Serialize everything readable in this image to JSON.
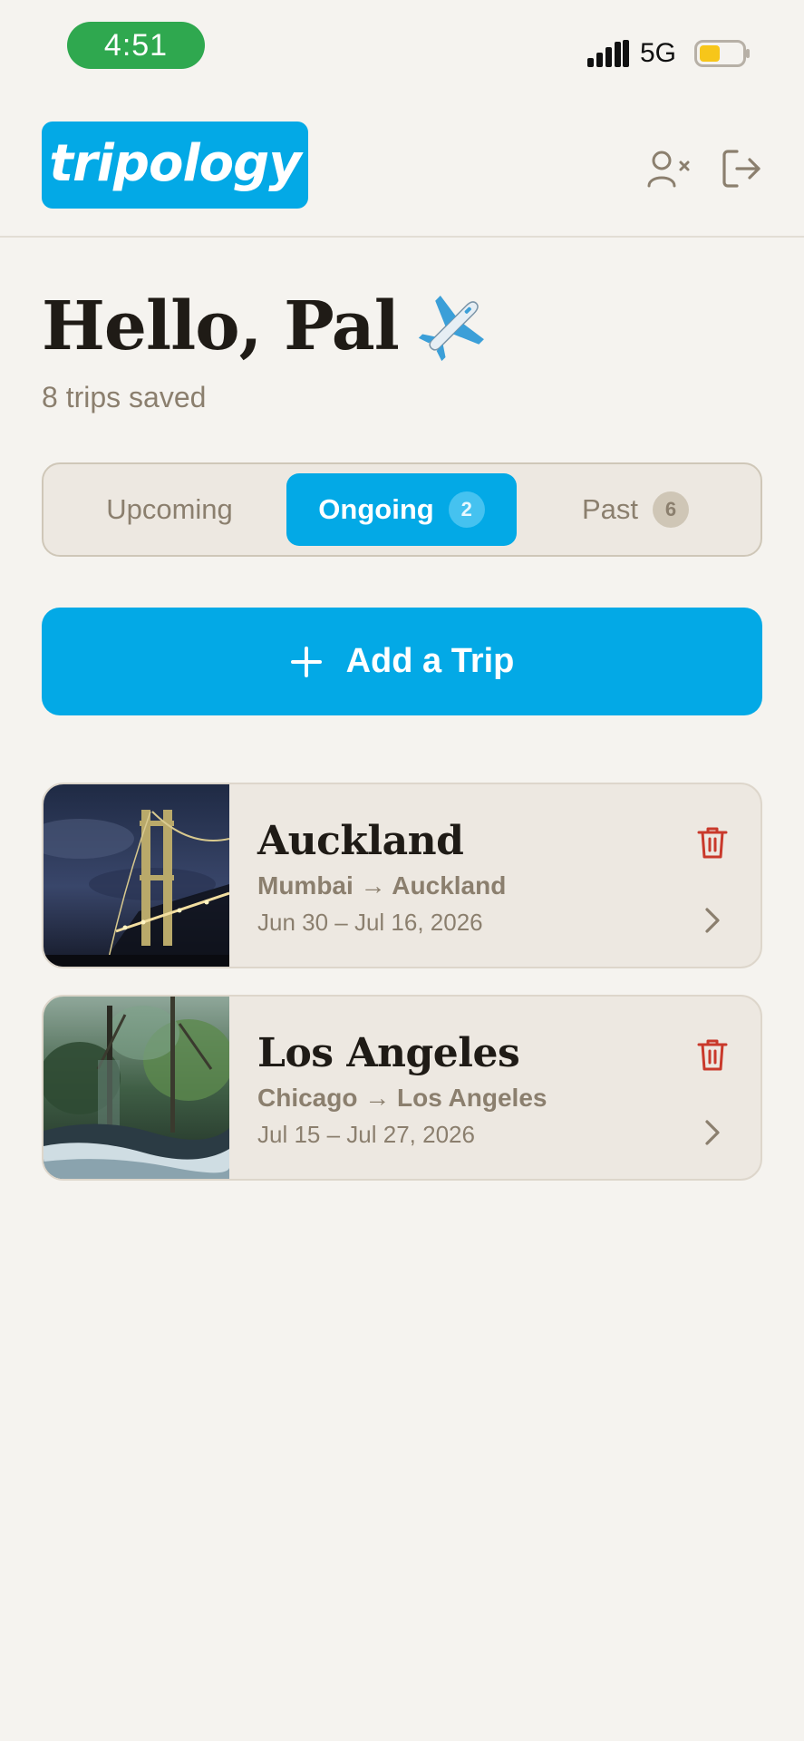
{
  "status_bar": {
    "time": "4:51",
    "network": "5G"
  },
  "header": {
    "logo_text": "tripology",
    "remove_user_icon": "user-remove-icon",
    "logout_icon": "logout-icon"
  },
  "greeting": {
    "text": "Hello, Pal",
    "emoji": "airplane-icon"
  },
  "summary": "8 trips saved",
  "tabs": [
    {
      "label": "Upcoming",
      "count": null,
      "active": false
    },
    {
      "label": "Ongoing",
      "count": "2",
      "active": true
    },
    {
      "label": "Past",
      "count": "6",
      "active": false
    }
  ],
  "add_trip": {
    "label": "Add a Trip"
  },
  "trips": [
    {
      "title": "Auckland",
      "route": "Mumbai → Auckland",
      "dates": "Jun 30 – Jul 16, 2026",
      "image": "bridge-at-night"
    },
    {
      "title": "Los Angeles",
      "route": "Chicago → Los Angeles",
      "dates": "Jul 15 – Jul 27, 2026",
      "image": "forest-river"
    }
  ],
  "colors": {
    "accent": "#03a9e6",
    "background": "#f5f3ef",
    "card": "#ede8e1",
    "muted_text": "#8b7f6e",
    "danger": "#c9392b",
    "status_green": "#2fa84f"
  }
}
